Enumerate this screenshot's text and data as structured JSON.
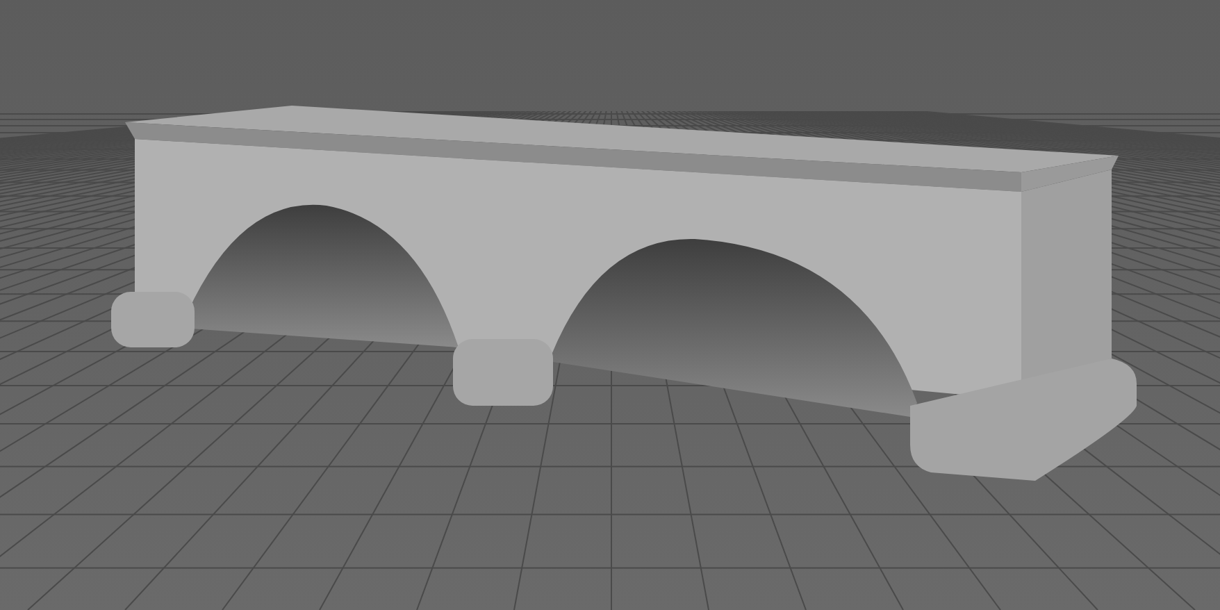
{
  "viewport": {
    "kind": "perspective",
    "grid_visible": true
  }
}
